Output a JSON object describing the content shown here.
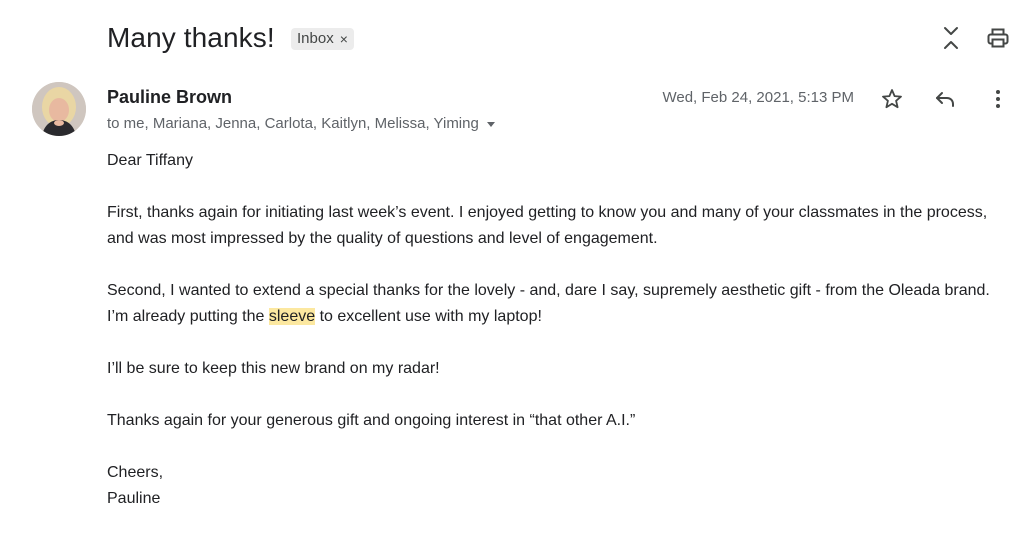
{
  "header": {
    "subject": "Many thanks!",
    "label": "Inbox",
    "label_remove": "×"
  },
  "sender": {
    "name": "Pauline Brown",
    "recipients": "to me, Mariana, Jenna, Carlota, Kaitlyn, Melissa, Yiming",
    "timestamp": "Wed, Feb 24, 2021, 5:13 PM"
  },
  "icons": {
    "expand_collapse": "unfold-icon",
    "print": "print-icon",
    "star": "star-icon",
    "reply": "reply-icon",
    "more": "more-vert-icon",
    "recipients_dropdown": "caret-down-icon"
  },
  "message": {
    "greeting": "Dear Tiffany",
    "p1": "First, thanks again for initiating last week’s event.  I enjoyed getting to know you and many of your classmates in the process, and was most impressed by the quality of questions and level of engagement.",
    "p2_before": "Second, I wanted to extend a special thanks for the lovely - and, dare I say, supremely aesthetic gift - from the Oleada brand.  I’m already putting the ",
    "p2_highlight": "sleeve",
    "p2_after": " to excellent use with my laptop!",
    "p3": "I’ll be sure to keep this new brand on my radar!",
    "p4": "Thanks again for your generous gift and ongoing interest in “that other A.I.”",
    "closing": "Cheers,",
    "signature": "Pauline"
  },
  "colors": {
    "text": "#202124",
    "muted": "#5f6368",
    "chip_bg": "#ececec",
    "highlight": "#fce8a0"
  }
}
